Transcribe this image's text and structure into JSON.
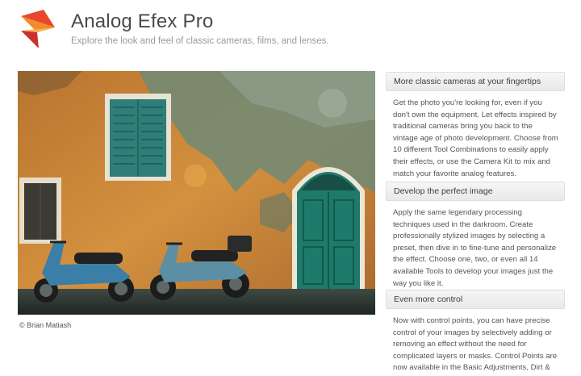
{
  "header": {
    "title": "Analog Efex Pro",
    "subtitle": "Explore the look and feel of classic cameras, films, and lenses."
  },
  "photo": {
    "credit": "© Brian Matiash"
  },
  "sections": [
    {
      "heading": "More classic cameras at your fingertips",
      "body": "Get the photo you're looking for, even if you don't own the equipment. Let effects inspired by traditional cameras bring you back to the vintage age of photo development. Choose from 10 different Tool Combinations to easily apply their effects, or use the Camera Kit to mix and match your favorite analog features."
    },
    {
      "heading": "Develop the perfect image",
      "body": "Apply the same legendary processing techniques used in the darkroom. Create professionally stylized images by selecting a preset, then dive in to fine-tune and personalize the effect. Choose one, two, or even all 14 available Tools to develop your images just the way you like it."
    },
    {
      "heading": "Even more control",
      "body": "Now with control points, you can have precise control of your images by selectively adding or removing an effect without the need for complicated layers or masks. Control Points are now available in the Basic Adjustments, Dirt & Scratches, Light Leaks, and Photo Plate Tools."
    }
  ]
}
